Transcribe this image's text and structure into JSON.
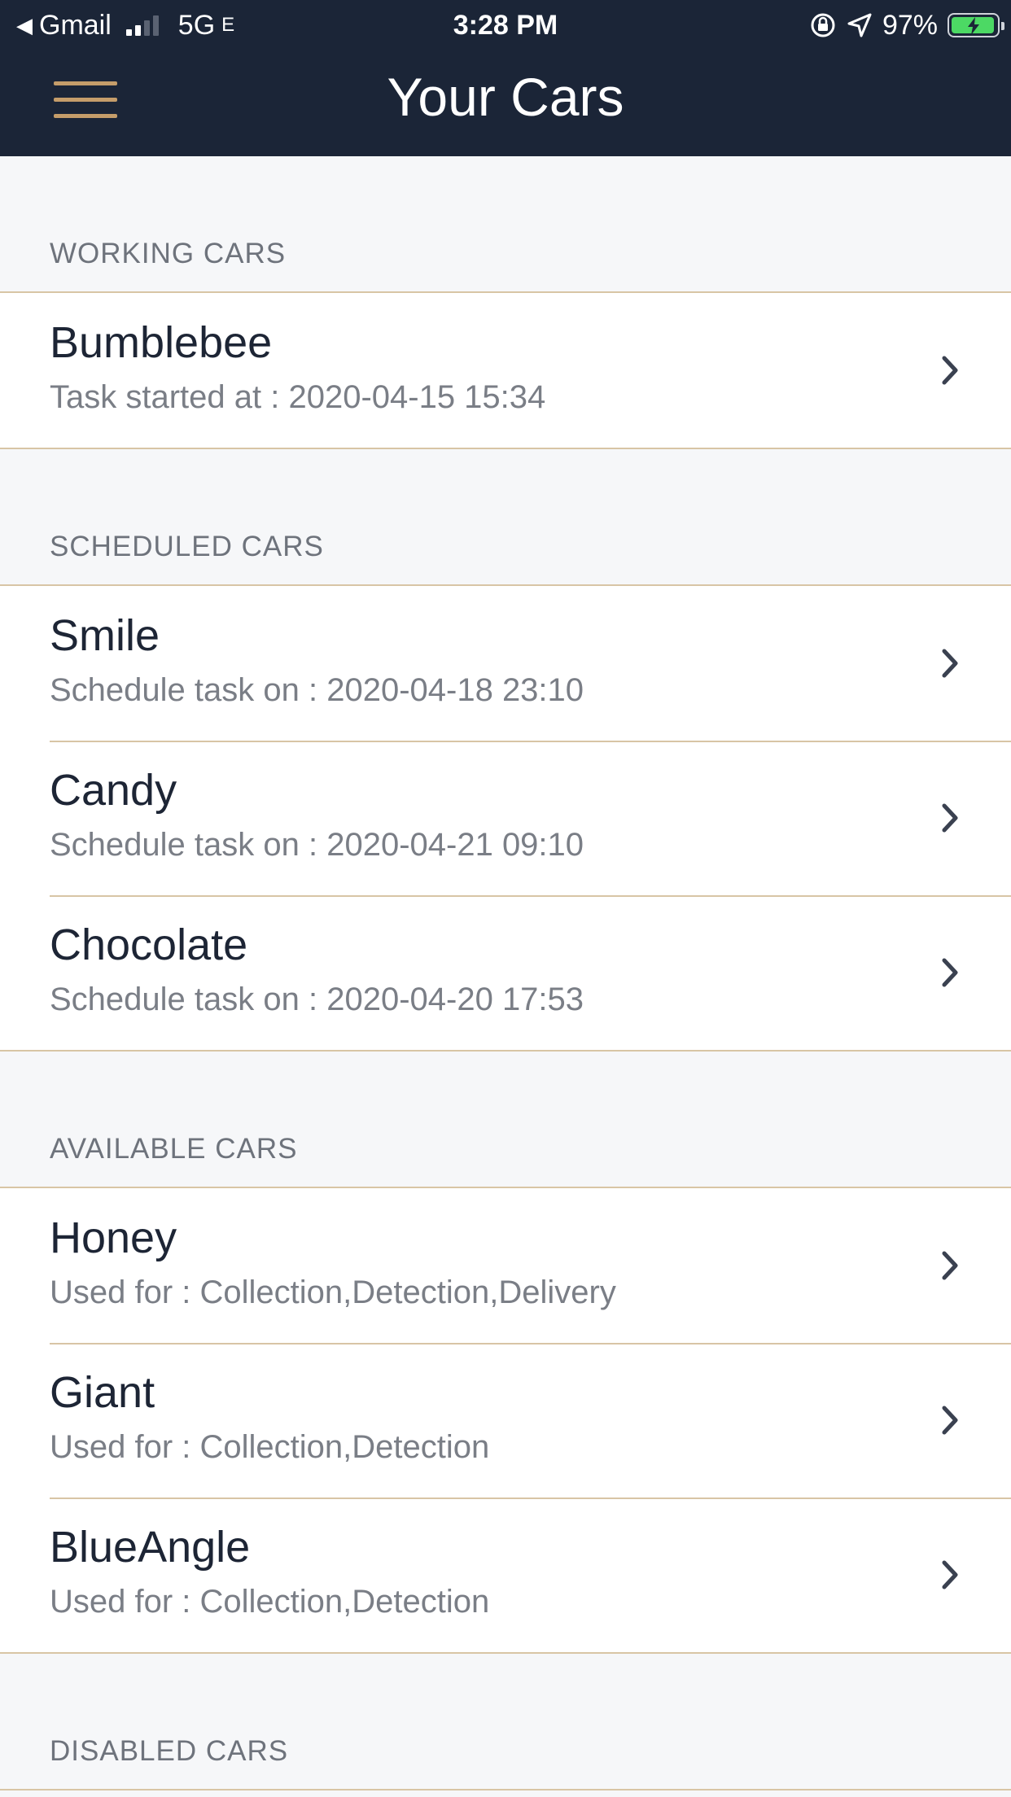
{
  "status_bar": {
    "back_arrow": "◀",
    "carrier": "Gmail",
    "network": "5G",
    "network_suffix": "E",
    "time": "3:28 PM",
    "battery_percent": "97%",
    "battery_level": 0.97,
    "battery_color": "#4cd964"
  },
  "header": {
    "title": "Your Cars",
    "menu_icon": "hamburger-menu-icon",
    "background_color": "#1b2537",
    "accent_color": "#c59d6a"
  },
  "sections": [
    {
      "label": "WORKING CARS",
      "items": [
        {
          "name": "Bumblebee",
          "detail": "Task started at : 2020-04-15 15:34"
        }
      ]
    },
    {
      "label": "SCHEDULED CARS",
      "items": [
        {
          "name": "Smile",
          "detail": "Schedule task on : 2020-04-18 23:10"
        },
        {
          "name": "Candy",
          "detail": "Schedule task on : 2020-04-21 09:10"
        },
        {
          "name": "Chocolate",
          "detail": "Schedule task on : 2020-04-20 17:53"
        }
      ]
    },
    {
      "label": "AVAILABLE CARS",
      "items": [
        {
          "name": "Honey",
          "detail": "Used for : Collection,Detection,Delivery"
        },
        {
          "name": "Giant",
          "detail": "Used for : Collection,Detection"
        },
        {
          "name": "BlueAngle",
          "detail": "Used for : Collection,Detection"
        }
      ]
    },
    {
      "label": "DISABLED CARS",
      "items": []
    }
  ]
}
